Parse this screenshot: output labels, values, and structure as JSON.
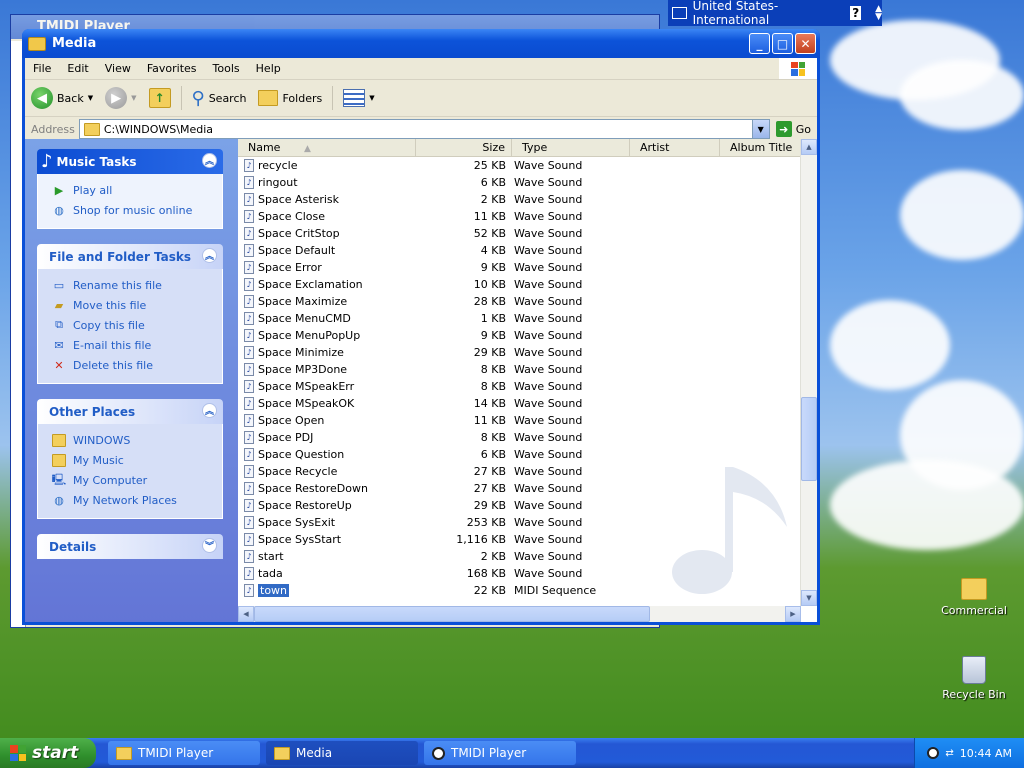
{
  "desktop": {
    "icons": [
      {
        "label": "Commercial"
      },
      {
        "label": "Recycle Bin"
      }
    ]
  },
  "background_window": {
    "title": "TMIDI Player"
  },
  "language_bar": {
    "label": "United States-International",
    "help": "?"
  },
  "window": {
    "title": "Media",
    "menu": [
      "File",
      "Edit",
      "View",
      "Favorites",
      "Tools",
      "Help"
    ],
    "toolbar": {
      "back": "Back",
      "search": "Search",
      "folders": "Folders"
    },
    "address": {
      "label": "Address",
      "value": "C:\\WINDOWS\\Media",
      "go": "Go"
    }
  },
  "task_pane": {
    "music_tasks": {
      "title": "Music Tasks",
      "links": [
        "Play all",
        "Shop for music online"
      ]
    },
    "file_tasks": {
      "title": "File and Folder Tasks",
      "links": [
        "Rename this file",
        "Move this file",
        "Copy this file",
        "E-mail this file",
        "Delete this file"
      ]
    },
    "other_places": {
      "title": "Other Places",
      "links": [
        "WINDOWS",
        "My Music",
        "My Computer",
        "My Network Places"
      ]
    },
    "details": {
      "title": "Details"
    }
  },
  "list": {
    "columns": [
      "Name",
      "Size",
      "Type",
      "Artist",
      "Album Title"
    ],
    "rows": [
      {
        "name": "recycle",
        "size": "25 KB",
        "type": "Wave Sound"
      },
      {
        "name": "ringout",
        "size": "6 KB",
        "type": "Wave Sound"
      },
      {
        "name": "Space Asterisk",
        "size": "2 KB",
        "type": "Wave Sound"
      },
      {
        "name": "Space Close",
        "size": "11 KB",
        "type": "Wave Sound"
      },
      {
        "name": "Space CritStop",
        "size": "52 KB",
        "type": "Wave Sound"
      },
      {
        "name": "Space Default",
        "size": "4 KB",
        "type": "Wave Sound"
      },
      {
        "name": "Space Error",
        "size": "9 KB",
        "type": "Wave Sound"
      },
      {
        "name": "Space Exclamation",
        "size": "10 KB",
        "type": "Wave Sound"
      },
      {
        "name": "Space Maximize",
        "size": "28 KB",
        "type": "Wave Sound"
      },
      {
        "name": "Space MenuCMD",
        "size": "1 KB",
        "type": "Wave Sound"
      },
      {
        "name": "Space MenuPopUp",
        "size": "9 KB",
        "type": "Wave Sound"
      },
      {
        "name": "Space Minimize",
        "size": "29 KB",
        "type": "Wave Sound"
      },
      {
        "name": "Space MP3Done",
        "size": "8 KB",
        "type": "Wave Sound"
      },
      {
        "name": "Space MSpeakErr",
        "size": "8 KB",
        "type": "Wave Sound"
      },
      {
        "name": "Space MSpeakOK",
        "size": "14 KB",
        "type": "Wave Sound"
      },
      {
        "name": "Space Open",
        "size": "11 KB",
        "type": "Wave Sound"
      },
      {
        "name": "Space PDJ",
        "size": "8 KB",
        "type": "Wave Sound"
      },
      {
        "name": "Space Question",
        "size": "6 KB",
        "type": "Wave Sound"
      },
      {
        "name": "Space Recycle",
        "size": "27 KB",
        "type": "Wave Sound"
      },
      {
        "name": "Space RestoreDown",
        "size": "27 KB",
        "type": "Wave Sound"
      },
      {
        "name": "Space RestoreUp",
        "size": "29 KB",
        "type": "Wave Sound"
      },
      {
        "name": "Space SysExit",
        "size": "253 KB",
        "type": "Wave Sound"
      },
      {
        "name": "Space SysStart",
        "size": "1,116 KB",
        "type": "Wave Sound"
      },
      {
        "name": "start",
        "size": "2 KB",
        "type": "Wave Sound"
      },
      {
        "name": "tada",
        "size": "168 KB",
        "type": "Wave Sound"
      },
      {
        "name": "town",
        "size": "22 KB",
        "type": "MIDI Sequence",
        "selected": true
      }
    ]
  },
  "taskbar": {
    "start": "start",
    "items": [
      "TMIDI Player",
      "Media",
      "TMIDI Player"
    ],
    "clock": "10:44 AM"
  }
}
